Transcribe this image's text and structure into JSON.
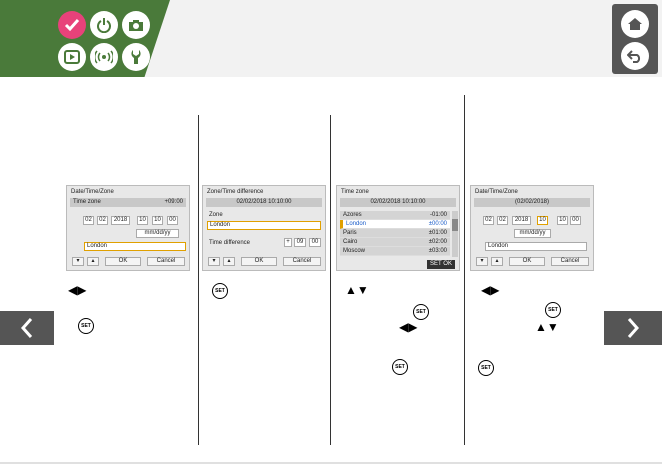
{
  "panel1": {
    "title": "Date/Time/Zone",
    "zone_label": "Time zone",
    "zone_value": "+09:00",
    "date_month": "02",
    "date_day": "02",
    "date_year": "2018",
    "time_h": "10",
    "time_m": "10",
    "time_s": "00",
    "format": "mm/dd/yy",
    "city": "London",
    "ok": "OK",
    "cancel": "Cancel"
  },
  "panel2": {
    "title": "Zone/Time difference",
    "datetime": "02/02/2018 10:10:00",
    "zone_label": "Zone",
    "zone_value": "London",
    "diff_label": "Time difference",
    "diff_sign": "+",
    "diff_h": "09",
    "diff_m": "00",
    "ok": "OK",
    "cancel": "Cancel"
  },
  "panel3": {
    "title": "Time zone",
    "datetime": "02/02/2018 10:10:00",
    "zones": [
      {
        "name": "Azores",
        "offset": "-01:00"
      },
      {
        "name": "London",
        "offset": "±00:00"
      },
      {
        "name": "Paris",
        "offset": "±01:00"
      },
      {
        "name": "Cairo",
        "offset": "±02:00"
      },
      {
        "name": "Moscow",
        "offset": "±03:00"
      }
    ],
    "set_label": "SET",
    "ok": "OK"
  },
  "panel4": {
    "title": "Date/Time/Zone",
    "date_display": "(02/02/2018)",
    "date_month": "02",
    "date_day": "02",
    "date_year": "2018",
    "time_h": "10",
    "time_m": "10",
    "time_s": "00",
    "format": "mm/dd/yy",
    "city": "London",
    "ok": "OK",
    "cancel": "Cancel"
  },
  "set_icon_label": "SET",
  "colors": {
    "header_green": "#4a7a3a",
    "active_pink": "#e8427a",
    "nav_gray": "#555555",
    "highlight_orange": "#e0a000",
    "list_selected_blue": "#1a5cc8"
  }
}
